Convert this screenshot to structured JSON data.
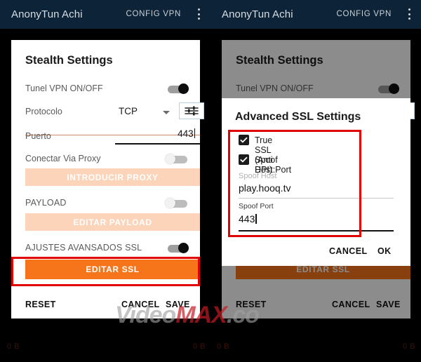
{
  "appbar": {
    "left": {
      "title": "AnonyTun Achi",
      "action": "CONFIG VPN",
      "menu_icon": "kebab-menu-icon"
    },
    "right": {
      "title": "AnonyTun Achi",
      "action": "CONFIG VPN",
      "menu_icon": "kebab-menu-icon"
    }
  },
  "settings": {
    "title": "Stealth Settings",
    "tunnel": {
      "label": "Tunel VPN ON/OFF",
      "state": "on"
    },
    "protocol": {
      "label": "Protocolo",
      "value": "TCP",
      "tune_icon": "tune-sliders-icon"
    },
    "port": {
      "label": "Puerto",
      "value": "443"
    },
    "proxy": {
      "label": "Conectar Via Proxy",
      "state": "off",
      "button": "INTRODUCIR PROXY"
    },
    "payload": {
      "label": "PAYLOAD",
      "state": "off",
      "button": "EDITAR PAYLOAD"
    },
    "ssl": {
      "label": "AJUSTES AVANSADOS SSL",
      "state": "on",
      "button": "EDITAR SSL"
    },
    "actions": {
      "reset": "RESET",
      "cancel": "CANCEL",
      "save": "SAVE"
    }
  },
  "dialog": {
    "title": "Advanced SSL Settings",
    "true_ssl": {
      "label": "True SSL (Anti DPI)",
      "checked": true
    },
    "spoof_host_port": {
      "label": "Spoof Host:Port",
      "checked": true
    },
    "spoof_host": {
      "placeholder": "Spoof Host",
      "value": "play.hooq.tv"
    },
    "spoof_port": {
      "label": "Spoof Port",
      "value": "443"
    },
    "actions": {
      "cancel": "CANCEL",
      "ok": "OK"
    }
  },
  "watermark": {
    "part1": "Video",
    "part2": "MAX",
    "part3": ".co"
  },
  "status": {
    "c1": "0 B",
    "c2": "0 B",
    "c3": "0 B",
    "c4": "0 B"
  },
  "colors": {
    "appbar": "#0d2338",
    "accent_orange": "#f7751a",
    "disabled_orange": "#fbd4ba",
    "highlight_red": "#e00000",
    "divider": "#c98a6b"
  }
}
